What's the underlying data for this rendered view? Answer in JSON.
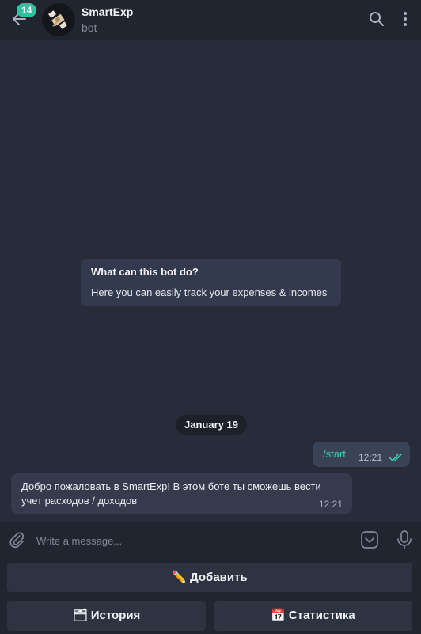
{
  "header": {
    "title": "SmartExp",
    "subtitle": "bot",
    "unread_badge": "14"
  },
  "chat": {
    "info_card": {
      "title": "What can this bot do?",
      "text": "Here you can easily track your expenses & incomes"
    },
    "date_separator": "January 19",
    "messages": [
      {
        "direction": "out",
        "text": "/start",
        "time": "12:21",
        "status": "read"
      },
      {
        "direction": "in",
        "text": "Добро пожаловать в SmartExp! В этом боте ты сможешь вести учет расходов / доходов",
        "time": "12:21"
      }
    ]
  },
  "composer": {
    "placeholder": "Write a message..."
  },
  "keyboard": {
    "row1": {
      "emoji": "✏️",
      "label": "Добавить"
    },
    "row2": [
      {
        "emoji": "🗂",
        "label": "История"
      },
      {
        "emoji": "📅",
        "label": "Статистика"
      }
    ]
  },
  "colors": {
    "accent": "#3fcbb1",
    "badge": "#2fc0a0",
    "header_bg": "#21252f",
    "chat_bg": "#282c3a"
  }
}
